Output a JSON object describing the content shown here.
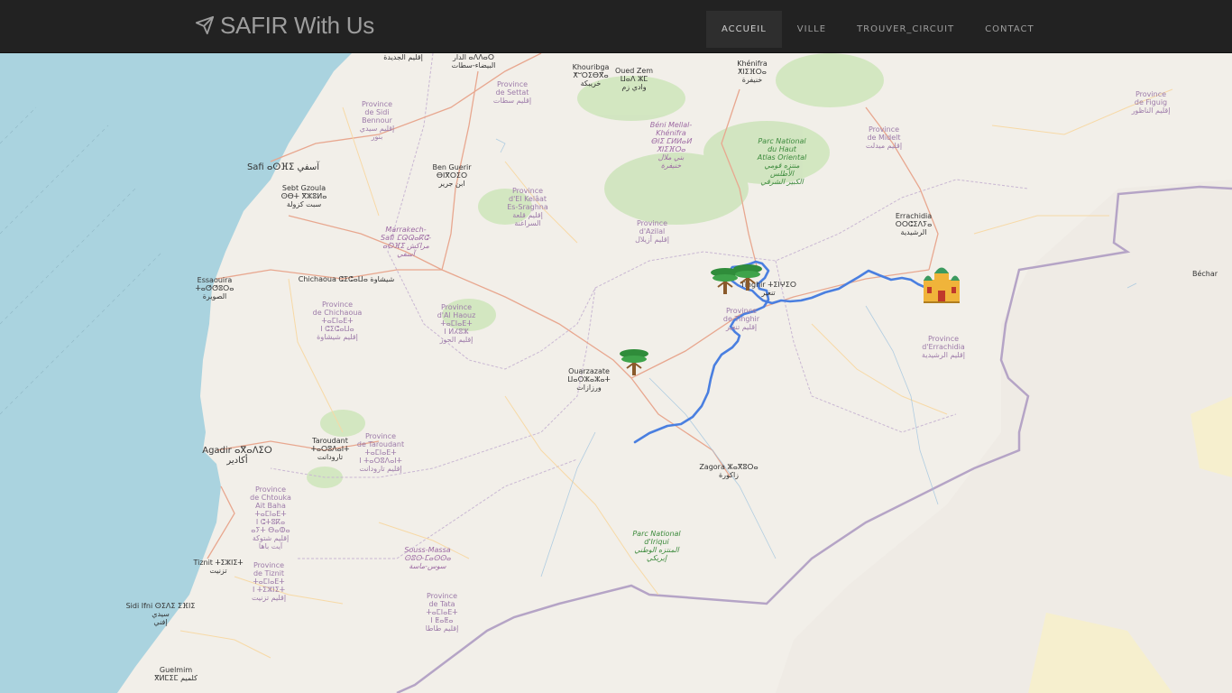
{
  "app": {
    "brand": "SAFIR With Us",
    "brand_icon": "paper-plane-icon"
  },
  "nav": {
    "items": [
      {
        "label": "ACCUEIL",
        "active": true
      },
      {
        "label": "VILLE",
        "active": false
      },
      {
        "label": "TROUVER_CIRCUIT",
        "active": false
      },
      {
        "label": "CONTACT",
        "active": false
      }
    ]
  },
  "map": {
    "colors": {
      "land": "#f2efe9",
      "sea": "#aad3df",
      "route": "#4a7fe0",
      "border": "#a795b8"
    },
    "markers": [
      {
        "name": "tree-icon",
        "place": "Ouarzazate"
      },
      {
        "name": "tree-icon",
        "place": "Tinghir"
      },
      {
        "name": "tree-icon",
        "place": "Tinghir"
      },
      {
        "name": "palace-icon",
        "place": "Errachidia"
      }
    ],
    "labels": {
      "safi": "Safi ⴰⵙⴼⵉ آسفي",
      "sebt_gzoula": "Sebt Gzoula\nⵙⴱⵜ ⴳⵣⵓⵍⴰ\nسبت كزولة",
      "essaouira": "Essaouira\nⵜⴰⵚⵚⵓⵔⴰ\nالصويرة",
      "chichaoua": "Chichaoua ⵛⵉⵛⴰⵡⴰ شيشاوة",
      "ben_guerir": "Ben Guerir\nⴱⵏⴳⵔⵉⵔ\nابن جرير",
      "khouribga": "Khouribga\nⵅⵯⵔⵉⴱⴳⴰ\nخريبكة",
      "oued_zem": "Oued Zem\nⵡⴰⴷ ⵣⵎ\nوادي زم",
      "khenifra": "Khénifra\nⵅⵏⵉⴼⵔⴰ\nخنيفرة",
      "errachidia": "Errachidia\nⵔⵔⵛⵉⴷⵢⴰ\nالرشيدية",
      "bechar": "Béchar",
      "tinghir": "Tinghir ⵜⵉⵏⵖⵉⵔ\nتنغير",
      "ouarzazate": "Ouarzazate\nⵡⴰⵔⵣⴰⵣⴰⵜ\nورزازات",
      "agadir": "Agadir ⴰⴳⴰⴷⵉⵔ\nأكادير",
      "taroudant": "Taroudant\nⵜⴰⵔⵓⴷⴰⵏⵜ\nتارودانت",
      "zagora": "Zagora ⵣⴰⴳⵓⵔⴰ\nزاكورة",
      "tiznit": "Tiznit ⵜⵉⵣⵏⵉⵜ\nتزنيت",
      "sidi_ifni": "Sidi Ifni ⵙⵉⴷⵉ ⵉⴼⵏⵉ\nسيدي\nإفني",
      "guelmim": "Guelmim\nⴳⵍⵎⵉⵎ كلميم",
      "prov_settat": "Province\nde Settat\nإقليم سطات",
      "prov_sidi_bennour": "Province\nde Sidi\nBennour\nإقليم سيدي\nبنور",
      "prov_kelaat": "Province\nd'El Kelâat\nEs-Sraghna\nإقليم قلعة\nالسراغنة",
      "prov_azilal": "Province\nd'Azilal\nإقليم أزيلال",
      "prov_midelt": "Province\nde Midelt\nإقليم ميدلت",
      "prov_figuig": "Province\nde Figuig\nإقليم الناظور",
      "prov_chichaoua": "Province\nde Chichaoua\nⵜⴰⵎⵏⴰⴹⵜ\nⵏ ⵛⵉⵛⴰⵡⴰ\nإقليم شيشاوة",
      "prov_al_haouz": "Province\nd'Al Haouz\nⵜⴰⵎⵏⴰⴹⵜ\nⵏ ⵍⵃⵓⵣ\nإقليم الحوز",
      "prov_tinghir": "Province\nde Tinghir\nإقليم تنغير",
      "prov_errachidia": "Province\nd'Errachidia\nإقليم الرشيدية",
      "prov_taroudant": "Province\nde Taroudant\nⵜⴰⵎⵏⴰⴹⵜ\nⵏ ⵜⴰⵔⵓⴷⴰⵏⵜ\nإقليم تارودانت",
      "prov_chtouka": "Province\nde Chtouka\nAit Baha\nⵜⴰⵎⵏⴰⴹⵜ\nⵏ ⵛⵜⵓⴽⴰ\nⴰⵢⵜ ⴱⴰⵀⴰ\nإقليم شتوكة\nآيت باها",
      "prov_tiznit": "Province\nde Tiznit\nⵜⴰⵎⵏⴰⴹⵜ\nⵏ ⵜⵉⵣⵏⵉⵜ\nإقليم تزنيت",
      "prov_tata": "Province\nde Tata\nⵜⴰⵎⵏⴰⴹⵜ\nⵏ ⵟⴰⵟⴰ\nإقليم طاطا",
      "region_marrakech": "Marrakech-\nSafi ⵎⵕⵕⴰⴽⵛ-\nⴰⵙⴼⵉ مراكش\nآسفي",
      "region_beni_mellal": "Béni Mellal-\nKhénifra\nⴱⵏⵉ ⵎⵍⵍⴰⵍ\nⵅⵏⵉⴼⵔⴰ\nبني ملال\nخنيفرة",
      "region_souss": "Souss-Massa\nⵙⵓⵙ-ⵎⴰⵙⵙⴰ\nسوس-ماسة",
      "park_haut_atlas": "Parc National\ndu Haut\nAtlas Oriental\nمنتزه قومي\nالأطلس\nالكبير الشرقي",
      "park_iriqui": "Parc National\nd'Iriqui\nالمنتزه الوطني\nإيريكي",
      "top_casa": "الدار ⴰⴷⴷⴰⵔ\nالبيضاء-سطات",
      "top_jadida": "إقليم الجديدة"
    }
  }
}
